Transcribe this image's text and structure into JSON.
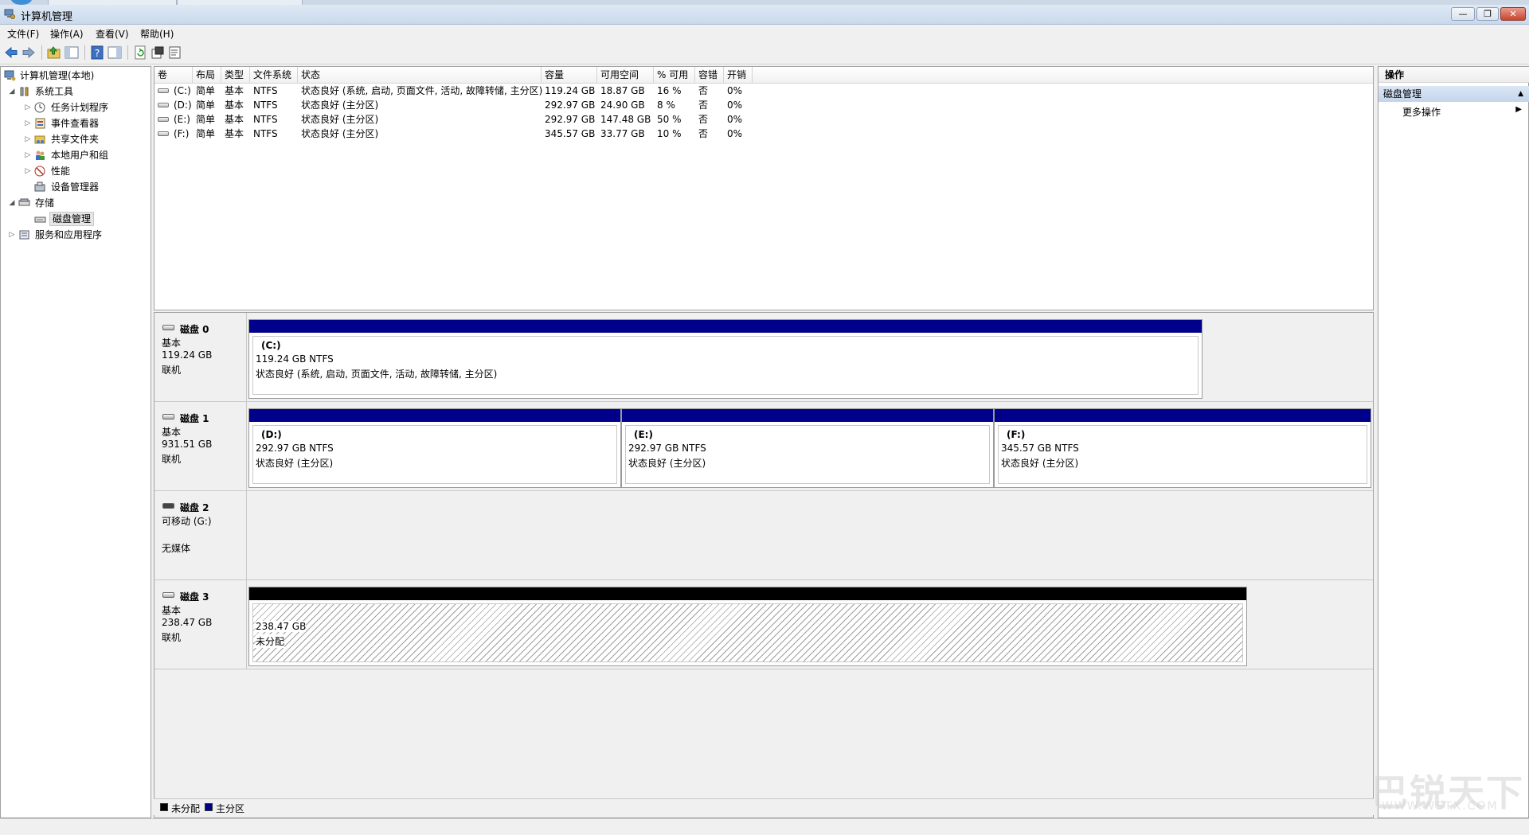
{
  "window": {
    "title": "计算机管理"
  },
  "menu": [
    {
      "label": "文件(F)"
    },
    {
      "label": "操作(A)"
    },
    {
      "label": "查看(V)"
    },
    {
      "label": "帮助(H)"
    }
  ],
  "toolbar": {
    "icons": [
      "back-icon",
      "forward-icon",
      "up-folder-icon",
      "show-hide-tree-icon",
      "help-icon",
      "show-hide-action-icon",
      "refresh-icon",
      "properties-icon",
      "export-list-icon"
    ]
  },
  "tree": {
    "items": [
      {
        "label": "计算机管理(本地)",
        "level": 0,
        "expander": "",
        "icon": "computer-management-icon"
      },
      {
        "label": "系统工具",
        "level": 1,
        "expander": "◢",
        "icon": "system-tools-icon"
      },
      {
        "label": "任务计划程序",
        "level": 2,
        "expander": "▷",
        "icon": "task-scheduler-icon"
      },
      {
        "label": "事件查看器",
        "level": 2,
        "expander": "▷",
        "icon": "event-viewer-icon"
      },
      {
        "label": "共享文件夹",
        "level": 2,
        "expander": "▷",
        "icon": "shared-folders-icon"
      },
      {
        "label": "本地用户和组",
        "level": 2,
        "expander": "▷",
        "icon": "local-users-icon"
      },
      {
        "label": "性能",
        "level": 2,
        "expander": "▷",
        "icon": "performance-icon"
      },
      {
        "label": "设备管理器",
        "level": 2,
        "expander": "",
        "icon": "device-manager-icon"
      },
      {
        "label": "存储",
        "level": 1,
        "expander": "◢",
        "icon": "storage-icon"
      },
      {
        "label": "磁盘管理",
        "level": 2,
        "expander": "",
        "icon": "disk-management-icon",
        "selected": true
      },
      {
        "label": "服务和应用程序",
        "level": 1,
        "expander": "▷",
        "icon": "services-apps-icon"
      }
    ]
  },
  "volumes": {
    "columns": [
      "卷",
      "布局",
      "类型",
      "文件系统",
      "状态",
      "容量",
      "可用空间",
      "% 可用",
      "容错",
      "开销"
    ],
    "rows": [
      [
        "(C:)",
        "简单",
        "基本",
        "NTFS",
        "状态良好 (系统, 启动, 页面文件, 活动, 故障转储, 主分区)",
        "119.24 GB",
        "18.87 GB",
        "16 %",
        "否",
        "0%"
      ],
      [
        "(D:)",
        "简单",
        "基本",
        "NTFS",
        "状态良好 (主分区)",
        "292.97 GB",
        "24.90 GB",
        "8 %",
        "否",
        "0%"
      ],
      [
        "(E:)",
        "简单",
        "基本",
        "NTFS",
        "状态良好 (主分区)",
        "292.97 GB",
        "147.48 GB",
        "50 %",
        "否",
        "0%"
      ],
      [
        "(F:)",
        "简单",
        "基本",
        "NTFS",
        "状态良好 (主分区)",
        "345.57 GB",
        "33.77 GB",
        "10 %",
        "否",
        "0%"
      ]
    ]
  },
  "disks": [
    {
      "name": "磁盘 0",
      "type": "基本",
      "size": "119.24 GB",
      "status": "联机",
      "partitions": [
        {
          "label": "(C:)",
          "size": "119.24 GB NTFS",
          "status": "状态良好 (系统, 启动, 页面文件, 活动, 故障转储, 主分区)"
        }
      ]
    },
    {
      "name": "磁盘 1",
      "type": "基本",
      "size": "931.51 GB",
      "status": "联机",
      "partitions": [
        {
          "label": "(D:)",
          "size": "292.97 GB NTFS",
          "status": "状态良好 (主分区)"
        },
        {
          "label": "(E:)",
          "size": "292.97 GB NTFS",
          "status": "状态良好 (主分区)"
        },
        {
          "label": "(F:)",
          "size": "345.57 GB NTFS",
          "status": "状态良好 (主分区)"
        }
      ]
    },
    {
      "name": "磁盘 2",
      "type": "可移动 (G:)",
      "size": "",
      "status": "无媒体",
      "partitions": []
    },
    {
      "name": "磁盘 3",
      "type": "基本",
      "size": "238.47 GB",
      "status": "联机",
      "partitions": [
        {
          "label": "",
          "size": "238.47 GB",
          "status": "未分配"
        }
      ]
    }
  ],
  "legend": [
    {
      "label": "未分配",
      "color": "#000000"
    },
    {
      "label": "主分区",
      "color": "#00008b"
    }
  ],
  "actions": {
    "header": "操作",
    "section": "磁盘管理",
    "more": "更多操作"
  },
  "colors": {
    "primary_partition": "#00008b",
    "unallocated": "#000000",
    "selection": "#c3d5ec"
  },
  "watermark": {
    "main": "巴锐天下",
    "sub": "WWW.WSTX.COM"
  }
}
